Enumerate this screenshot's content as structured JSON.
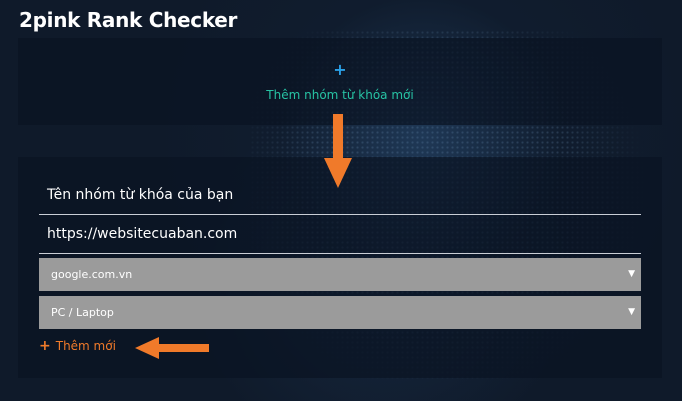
{
  "app": {
    "title": "2pink Rank Checker"
  },
  "add_group": {
    "icon": "plus-icon",
    "label": "Thêm nhóm từ khóa mới"
  },
  "form": {
    "group_name": "Tên nhóm từ khóa của bạn",
    "website_url": "https://websitecuaban.com",
    "search_engine": {
      "selected": "google.com.vn"
    },
    "device": {
      "selected": "PC / Laptop"
    },
    "add_new_label": "Thêm mới"
  },
  "colors": {
    "background": "#0f1a2a",
    "accent_teal": "#27c3a4",
    "accent_blue": "#2aa0e6",
    "accent_orange": "#f07a2a",
    "select_bg": "#9b9b9b"
  }
}
